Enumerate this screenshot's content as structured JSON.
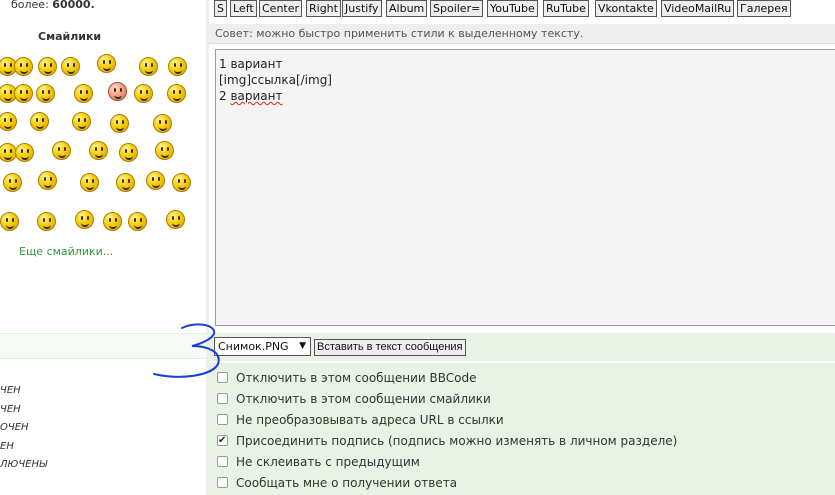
{
  "sidebar": {
    "limit_prefix": "более:",
    "limit_value": "60000.",
    "smilies_title": "Смайлики",
    "more_smilies": "Еще смайлики...",
    "status_items": [
      "ЧЕН",
      "ЧЕН",
      "ОЧЕН",
      "ЕН",
      "ЛЮЧЕНЫ"
    ],
    "status_item_first": "ЧЕН"
  },
  "toolbar": {
    "buttons": [
      "S",
      "Left",
      "Center",
      "Right",
      "Justify",
      "Album",
      "Spoiler=",
      "YouTube",
      "RuTube",
      "Vkontakte",
      "VideoMailRu",
      "Галерея"
    ]
  },
  "hint": "Совет: можно быстро применить стили к выделенному тексту.",
  "editor": {
    "line1": "1 вариант",
    "line2": "[img]ссылка[/img]",
    "line3": "",
    "line4_prefix": "2 ",
    "line4_word": "вариант"
  },
  "attachment": {
    "file_selected": "Снимок.PNG",
    "insert_label": "Вставить в текст сообщения"
  },
  "options": [
    {
      "label": "Отключить в этом сообщении BBCode",
      "checked": false
    },
    {
      "label": "Отключить в этом сообщении смайлики",
      "checked": false
    },
    {
      "label": "Не преобразовывать адреса URL в ссылки",
      "checked": false
    },
    {
      "label": "Присоединить подпись (подпись можно изменять в личном разделе)",
      "checked": true
    },
    {
      "label": "Не склеивать с предыдущим",
      "checked": false
    },
    {
      "label": "Сообщать мне о получении ответа",
      "checked": false
    }
  ],
  "annotation_color": "#1a3fd6"
}
